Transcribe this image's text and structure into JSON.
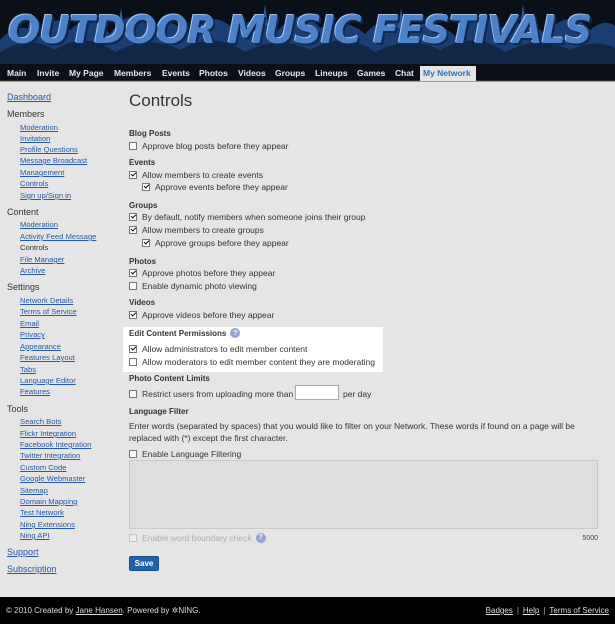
{
  "header": {
    "site_title": "OUTDOOR MUSIC FESTIVALS"
  },
  "nav": {
    "tabs": [
      {
        "label": "Main"
      },
      {
        "label": "Invite"
      },
      {
        "label": "My Page"
      },
      {
        "label": "Members"
      },
      {
        "label": "Events"
      },
      {
        "label": "Photos"
      },
      {
        "label": "Videos"
      },
      {
        "label": "Groups"
      },
      {
        "label": "Lineups"
      },
      {
        "label": "Games"
      },
      {
        "label": "Chat"
      },
      {
        "label": "My Network",
        "active": true
      }
    ]
  },
  "sidebar": {
    "dashboard": "Dashboard",
    "members_head": "Members",
    "members_links": [
      "Moderation",
      "Invitation",
      "Profile Questions",
      "Message Broadcast",
      "Management",
      "Controls",
      "Sign up/Sign in"
    ],
    "content_head": "Content",
    "content_moderation": "Moderation",
    "content_activity": "Activity Feed Message",
    "content_controls": "Controls",
    "content_file": "File Manager",
    "content_archive": "Archive",
    "settings_head": "Settings",
    "settings_links": [
      "Network Details",
      "Terms of Service",
      "Email",
      "Privacy",
      "Appearance",
      "Features Layout",
      "Tabs",
      "Language Editor",
      "Features"
    ],
    "tools_head": "Tools",
    "tools_links": [
      "Search Bots",
      "Flickr Integration",
      "Facebook Integration",
      "Twitter Integration",
      "Custom Code",
      "Google Webmaster",
      "Sitemap",
      "Domain Mapping",
      "Test Network",
      "Ning Extensions",
      "Ning API"
    ],
    "support": "Support",
    "subscription": "Subscription"
  },
  "main": {
    "title": "Controls",
    "blog": {
      "head": "Blog Posts",
      "approve": "Approve blog posts before they appear"
    },
    "events": {
      "head": "Events",
      "allow": "Allow members to create events",
      "approve": "Approve events before they appear"
    },
    "groups": {
      "head": "Groups",
      "notify": "By default, notify members when someone joins their group",
      "allow": "Allow members to create groups",
      "approve": "Approve groups before they appear"
    },
    "photos": {
      "head": "Photos",
      "approve": "Approve photos before they appear",
      "dynamic": "Enable dynamic photo viewing"
    },
    "videos": {
      "head": "Videos",
      "approve": "Approve videos before they appear"
    },
    "edit_perms": {
      "head": "Edit Content Permissions",
      "help": "?",
      "admins": "Allow administrators to edit member content",
      "mods": "Allow moderators to edit member content they are moderating"
    },
    "photo_limits": {
      "head": "Photo Content Limits",
      "restrict": "Restrict users from uploading more than",
      "limit_value": "",
      "per_day": "per day"
    },
    "language": {
      "head": "Language Filter",
      "desc": "Enter words (separated by spaces) that you would like to filter on your Network. These words if found on a page will be replaced with (*) except the first character.",
      "enable": "Enable Language Filtering",
      "words": "",
      "boundary": "Enable word boundary check",
      "help": "?",
      "counter": "5000"
    },
    "save": "Save"
  },
  "footer": {
    "copyright": "© 2010  Created by",
    "creator": "Jane Hansen",
    "powered": ".  Powered by",
    "ning": "NING.",
    "badges": "Badges",
    "help": "Help",
    "terms": "Terms of Service"
  }
}
